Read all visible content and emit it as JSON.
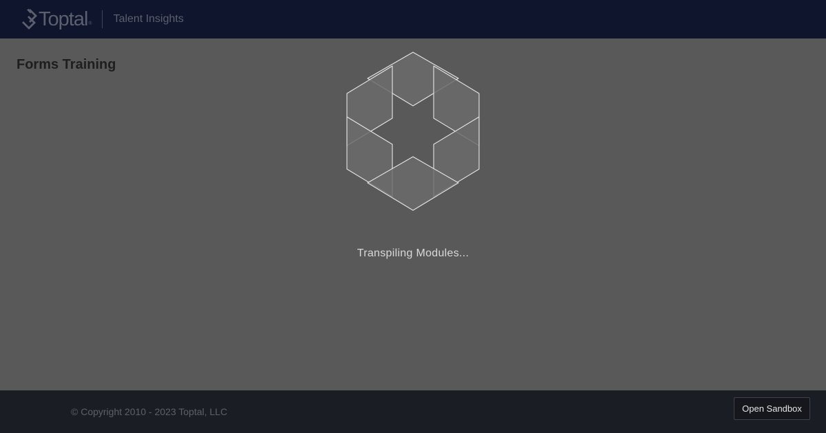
{
  "header": {
    "logo_text": "Toptal",
    "logo_reg": "®",
    "subtitle": "Talent Insights"
  },
  "main": {
    "title": "Forms Training"
  },
  "loader": {
    "status_text": "Transpiling Modules..."
  },
  "footer": {
    "copyright": "© Copyright 2010 - 2023 Toptal, LLC",
    "sandbox_button_label": "Open Sandbox"
  },
  "colors": {
    "header_bg": "#0f152c",
    "main_bg": "#595959",
    "footer_bg": "#1b1d24",
    "loader_stroke": "#e6e6e6"
  },
  "icons": {
    "logo_mark": "toptal-logo-icon",
    "loader": "hexagon-loader-icon"
  }
}
